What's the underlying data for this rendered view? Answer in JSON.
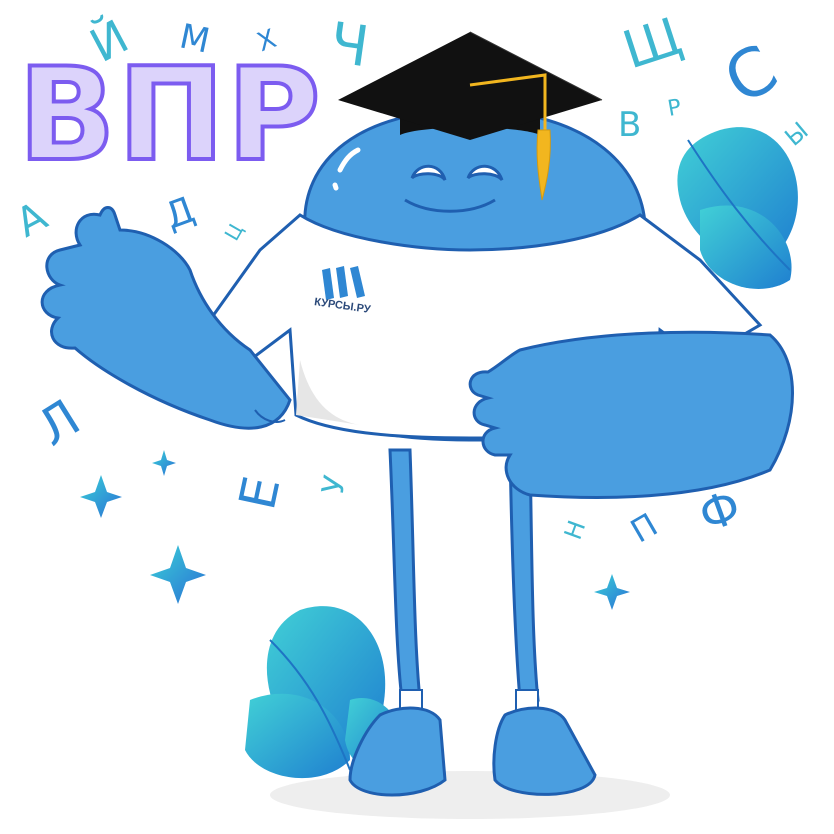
{
  "title": "ВПР",
  "brand": {
    "name": "КУРСЫ.РУ",
    "logo_icon": "kursy-logo-icon"
  },
  "character": {
    "description_icon": "blue-mascot-with-graduation-cap-icon"
  },
  "floating_letters": [
    {
      "char": "Й"
    },
    {
      "char": "М"
    },
    {
      "char": "Х"
    },
    {
      "char": "Ч"
    },
    {
      "char": "Щ"
    },
    {
      "char": "С"
    },
    {
      "char": "В"
    },
    {
      "char": "Р"
    },
    {
      "char": "Ы"
    },
    {
      "char": "А"
    },
    {
      "char": "Д"
    },
    {
      "char": "Ц"
    },
    {
      "char": "Л"
    },
    {
      "char": "Е"
    },
    {
      "char": "У"
    },
    {
      "char": "Ф"
    },
    {
      "char": "П"
    },
    {
      "char": "Н"
    }
  ],
  "colors": {
    "title_fill": "#dcd3fb",
    "title_stroke": "#7c5cf0",
    "mascot_blue": "#4a9ee0",
    "mascot_outline": "#1f5fb0",
    "teal_accent": "#3fc4d6",
    "cap_black": "#111111",
    "tassel_gold": "#f2b61f"
  }
}
